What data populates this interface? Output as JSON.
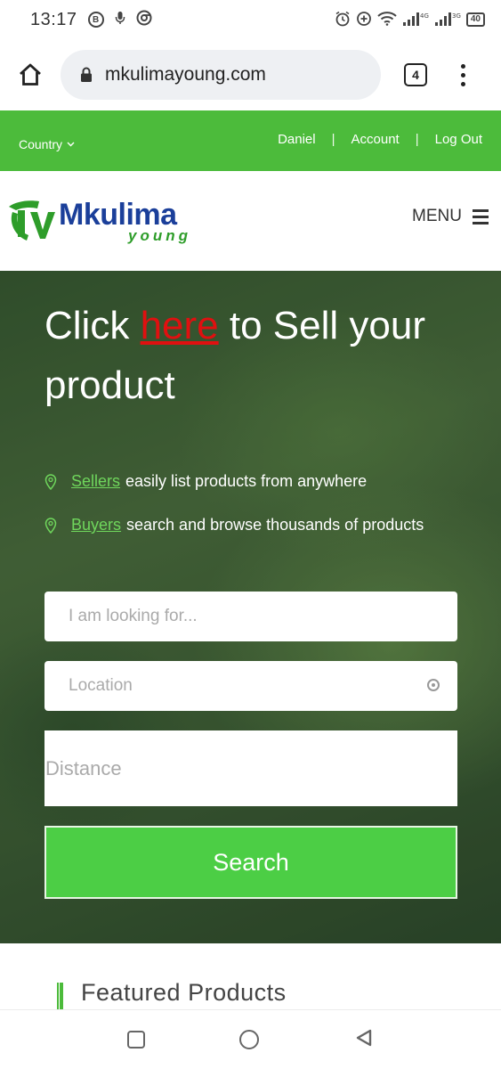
{
  "status_bar": {
    "time": "13:17",
    "left_icons": [
      "b-notification-icon",
      "mic-icon",
      "chrome-icon"
    ],
    "right_icons": [
      "alarm-icon",
      "data-saver-icon",
      "wifi-icon",
      "signal-4g-icon",
      "signal-3g-icon"
    ],
    "net1": "4G",
    "net2": "3G",
    "battery": "40"
  },
  "browser": {
    "url": "mkulimayoung.com",
    "tab_count": "4"
  },
  "top_nav": {
    "country_label": "Country",
    "user": "Daniel",
    "sep": "|",
    "account": "Account",
    "logout": "Log Out"
  },
  "header": {
    "logo_main": "Mkulima",
    "logo_sub": "young",
    "menu_label": "MENU"
  },
  "hero": {
    "title_pre": "Click ",
    "title_link": "here",
    "title_post": " to Sell your product",
    "bullets": [
      {
        "link": "Sellers",
        "text": "easily list products from anywhere"
      },
      {
        "link": "Buyers",
        "text": "search and browse thousands of products"
      }
    ]
  },
  "search_form": {
    "looking_placeholder": "I am looking for...",
    "location_placeholder": "Location",
    "distance_placeholder": "Distance",
    "search_label": "Search"
  },
  "featured": {
    "title": "Featured Products"
  },
  "colors": {
    "brand_green": "#4cbb3b",
    "logo_blue": "#1b3f9a",
    "link_red": "#e01010",
    "button_green": "#4cce45"
  }
}
